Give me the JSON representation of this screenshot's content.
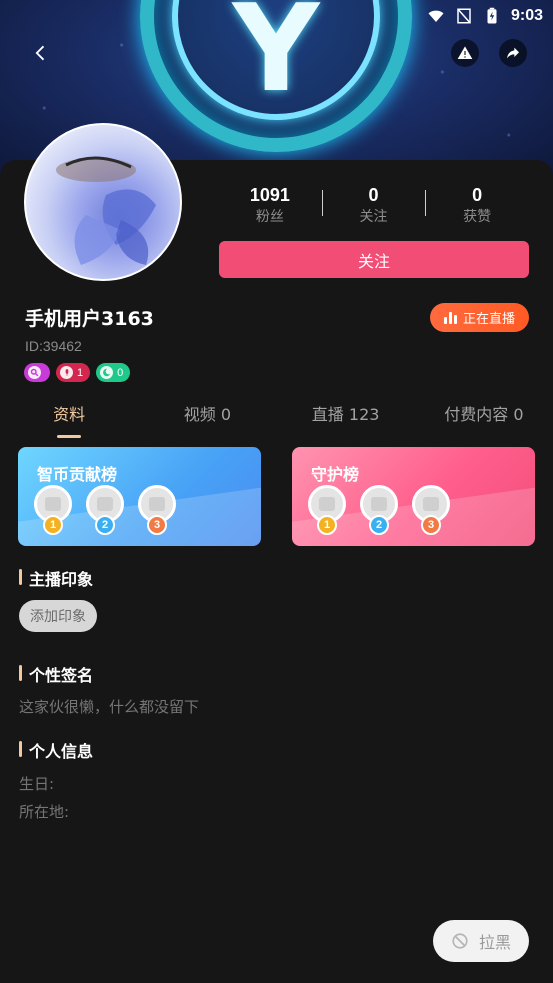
{
  "status_bar": {
    "time": "9:03"
  },
  "profile": {
    "username": "手机用户3163",
    "user_id": "ID:39462",
    "live_status": "正在直播",
    "follow_label": "关注"
  },
  "stats": [
    {
      "value": "1091",
      "label": "粉丝"
    },
    {
      "value": "0",
      "label": "关注"
    },
    {
      "value": "0",
      "label": "获赞"
    }
  ],
  "badges": [
    {
      "icon": "search-icon",
      "value": "",
      "color": "#c93bd8"
    },
    {
      "icon": "mic-icon",
      "value": "1",
      "color": "#d2284f"
    },
    {
      "icon": "moon-icon",
      "value": "0",
      "color": "#1fc98a"
    }
  ],
  "tabs": [
    {
      "label": "资料",
      "active": true
    },
    {
      "label": "视频 0",
      "active": false
    },
    {
      "label": "直播 123",
      "active": false
    },
    {
      "label": "付费内容 0",
      "active": false
    }
  ],
  "rank_cards": [
    {
      "title": "智币贡献榜",
      "ranks": [
        "1",
        "2",
        "3"
      ]
    },
    {
      "title": "守护榜",
      "ranks": [
        "1",
        "2",
        "3"
      ]
    }
  ],
  "sections": {
    "impression_title": "主播印象",
    "impression_button": "添加印象",
    "signature_title": "个性签名",
    "signature_text": "这家伙很懒，什么都没留下",
    "info_title": "个人信息",
    "birthday_label": "生日:",
    "location_label": "所在地:"
  },
  "block_label": "拉黑",
  "colors": {
    "accent_pink": "#f24d74",
    "accent_orange": "#ff5a24",
    "tab_active": "#f0c9a0",
    "background": "#171616"
  }
}
